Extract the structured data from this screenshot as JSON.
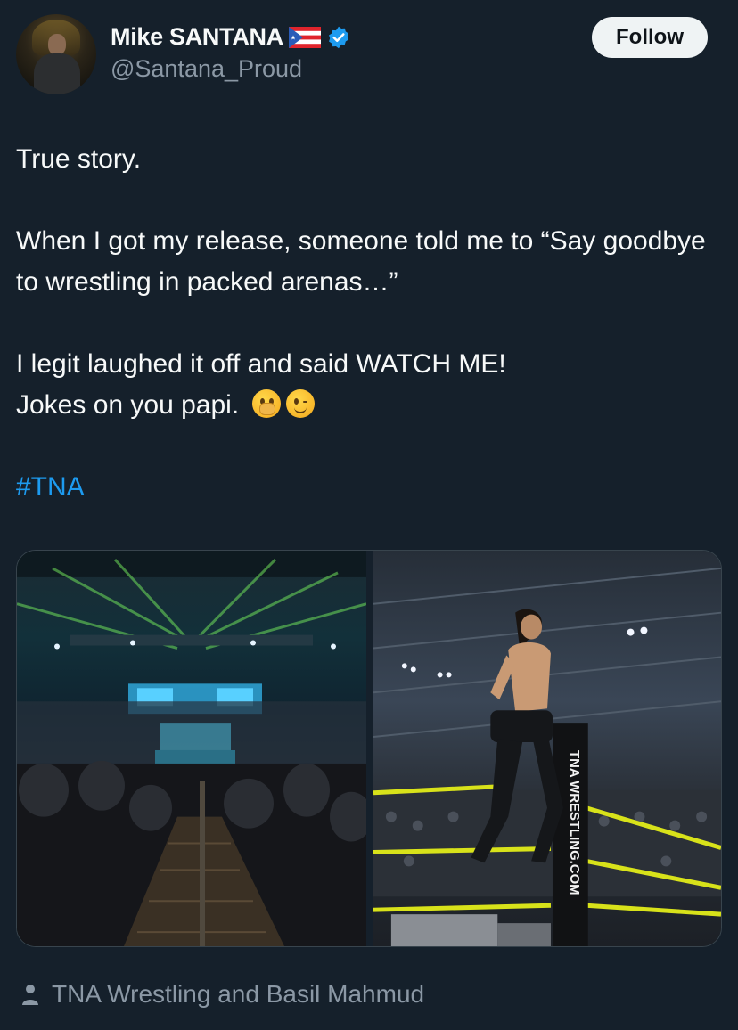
{
  "author": {
    "display_name": "Mike SANTANA",
    "handle": "@Santana_Proud",
    "flag_icon": "puerto-rico-flag-icon",
    "verified_icon": "verified-badge-icon",
    "verified_color": "#1d9bf0"
  },
  "follow_button": {
    "label": "Follow"
  },
  "tweet": {
    "line1": "True story.",
    "line2": "When I got my release, someone told me to “Say goodbye to wrestling in packed arenas…”",
    "line3": "I legit laughed it off and said WATCH ME!",
    "line4": "Jokes on you papi.",
    "emojis": [
      "face-with-hand-over-mouth-emoji",
      "winking-face-emoji"
    ],
    "hashtag": "#TNA"
  },
  "media": {
    "photos": [
      {
        "name": "arena-crowd-photo"
      },
      {
        "name": "wrestler-ring-photo",
        "ring_post_text": "TNA WRESTLING.COM"
      }
    ]
  },
  "attribution": {
    "icon": "person-icon",
    "text": "TNA Wrestling and Basil Mahmud"
  },
  "colors": {
    "background": "#15202b",
    "text": "#f7f9f9",
    "muted": "#8b98a5",
    "link": "#1d9bf0"
  }
}
